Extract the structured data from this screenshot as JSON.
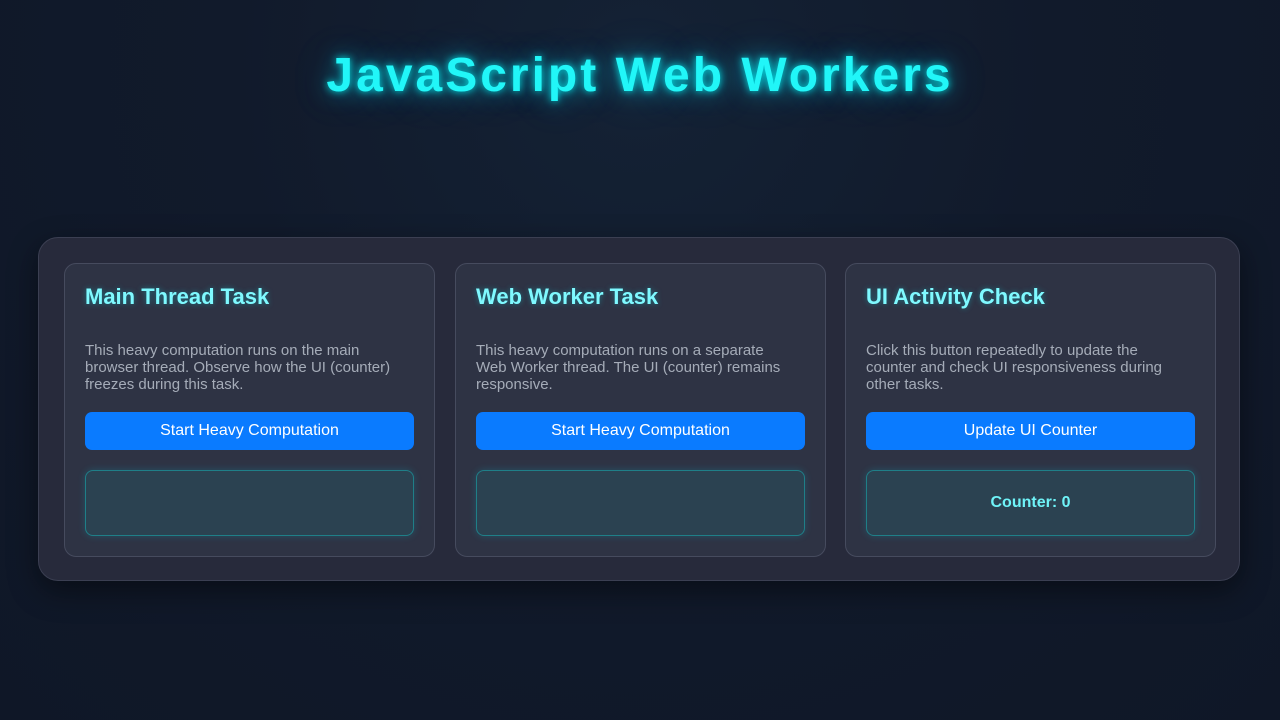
{
  "header": {
    "title": "JavaScript Web Workers"
  },
  "cards": [
    {
      "title": "Main Thread Task",
      "description": "This heavy computation runs on the main browser thread. Observe how the UI (counter) freezes during this task.",
      "button_label": "Start Heavy Computation",
      "output": ""
    },
    {
      "title": "Web Worker Task",
      "description": "This heavy computation runs on a separate Web Worker thread. The UI (counter) remains responsive.",
      "button_label": "Start Heavy Computation",
      "output": ""
    },
    {
      "title": "UI Activity Check",
      "description": "Click this button repeatedly to update the counter and check UI responsiveness during other tasks.",
      "button_label": "Update UI Counter",
      "output": "Counter: 0"
    }
  ],
  "colors": {
    "accent_cyan": "#21f6f8",
    "button_blue": "#0a7bff",
    "card_background": "#2e3344",
    "page_background": "#111a2b"
  }
}
